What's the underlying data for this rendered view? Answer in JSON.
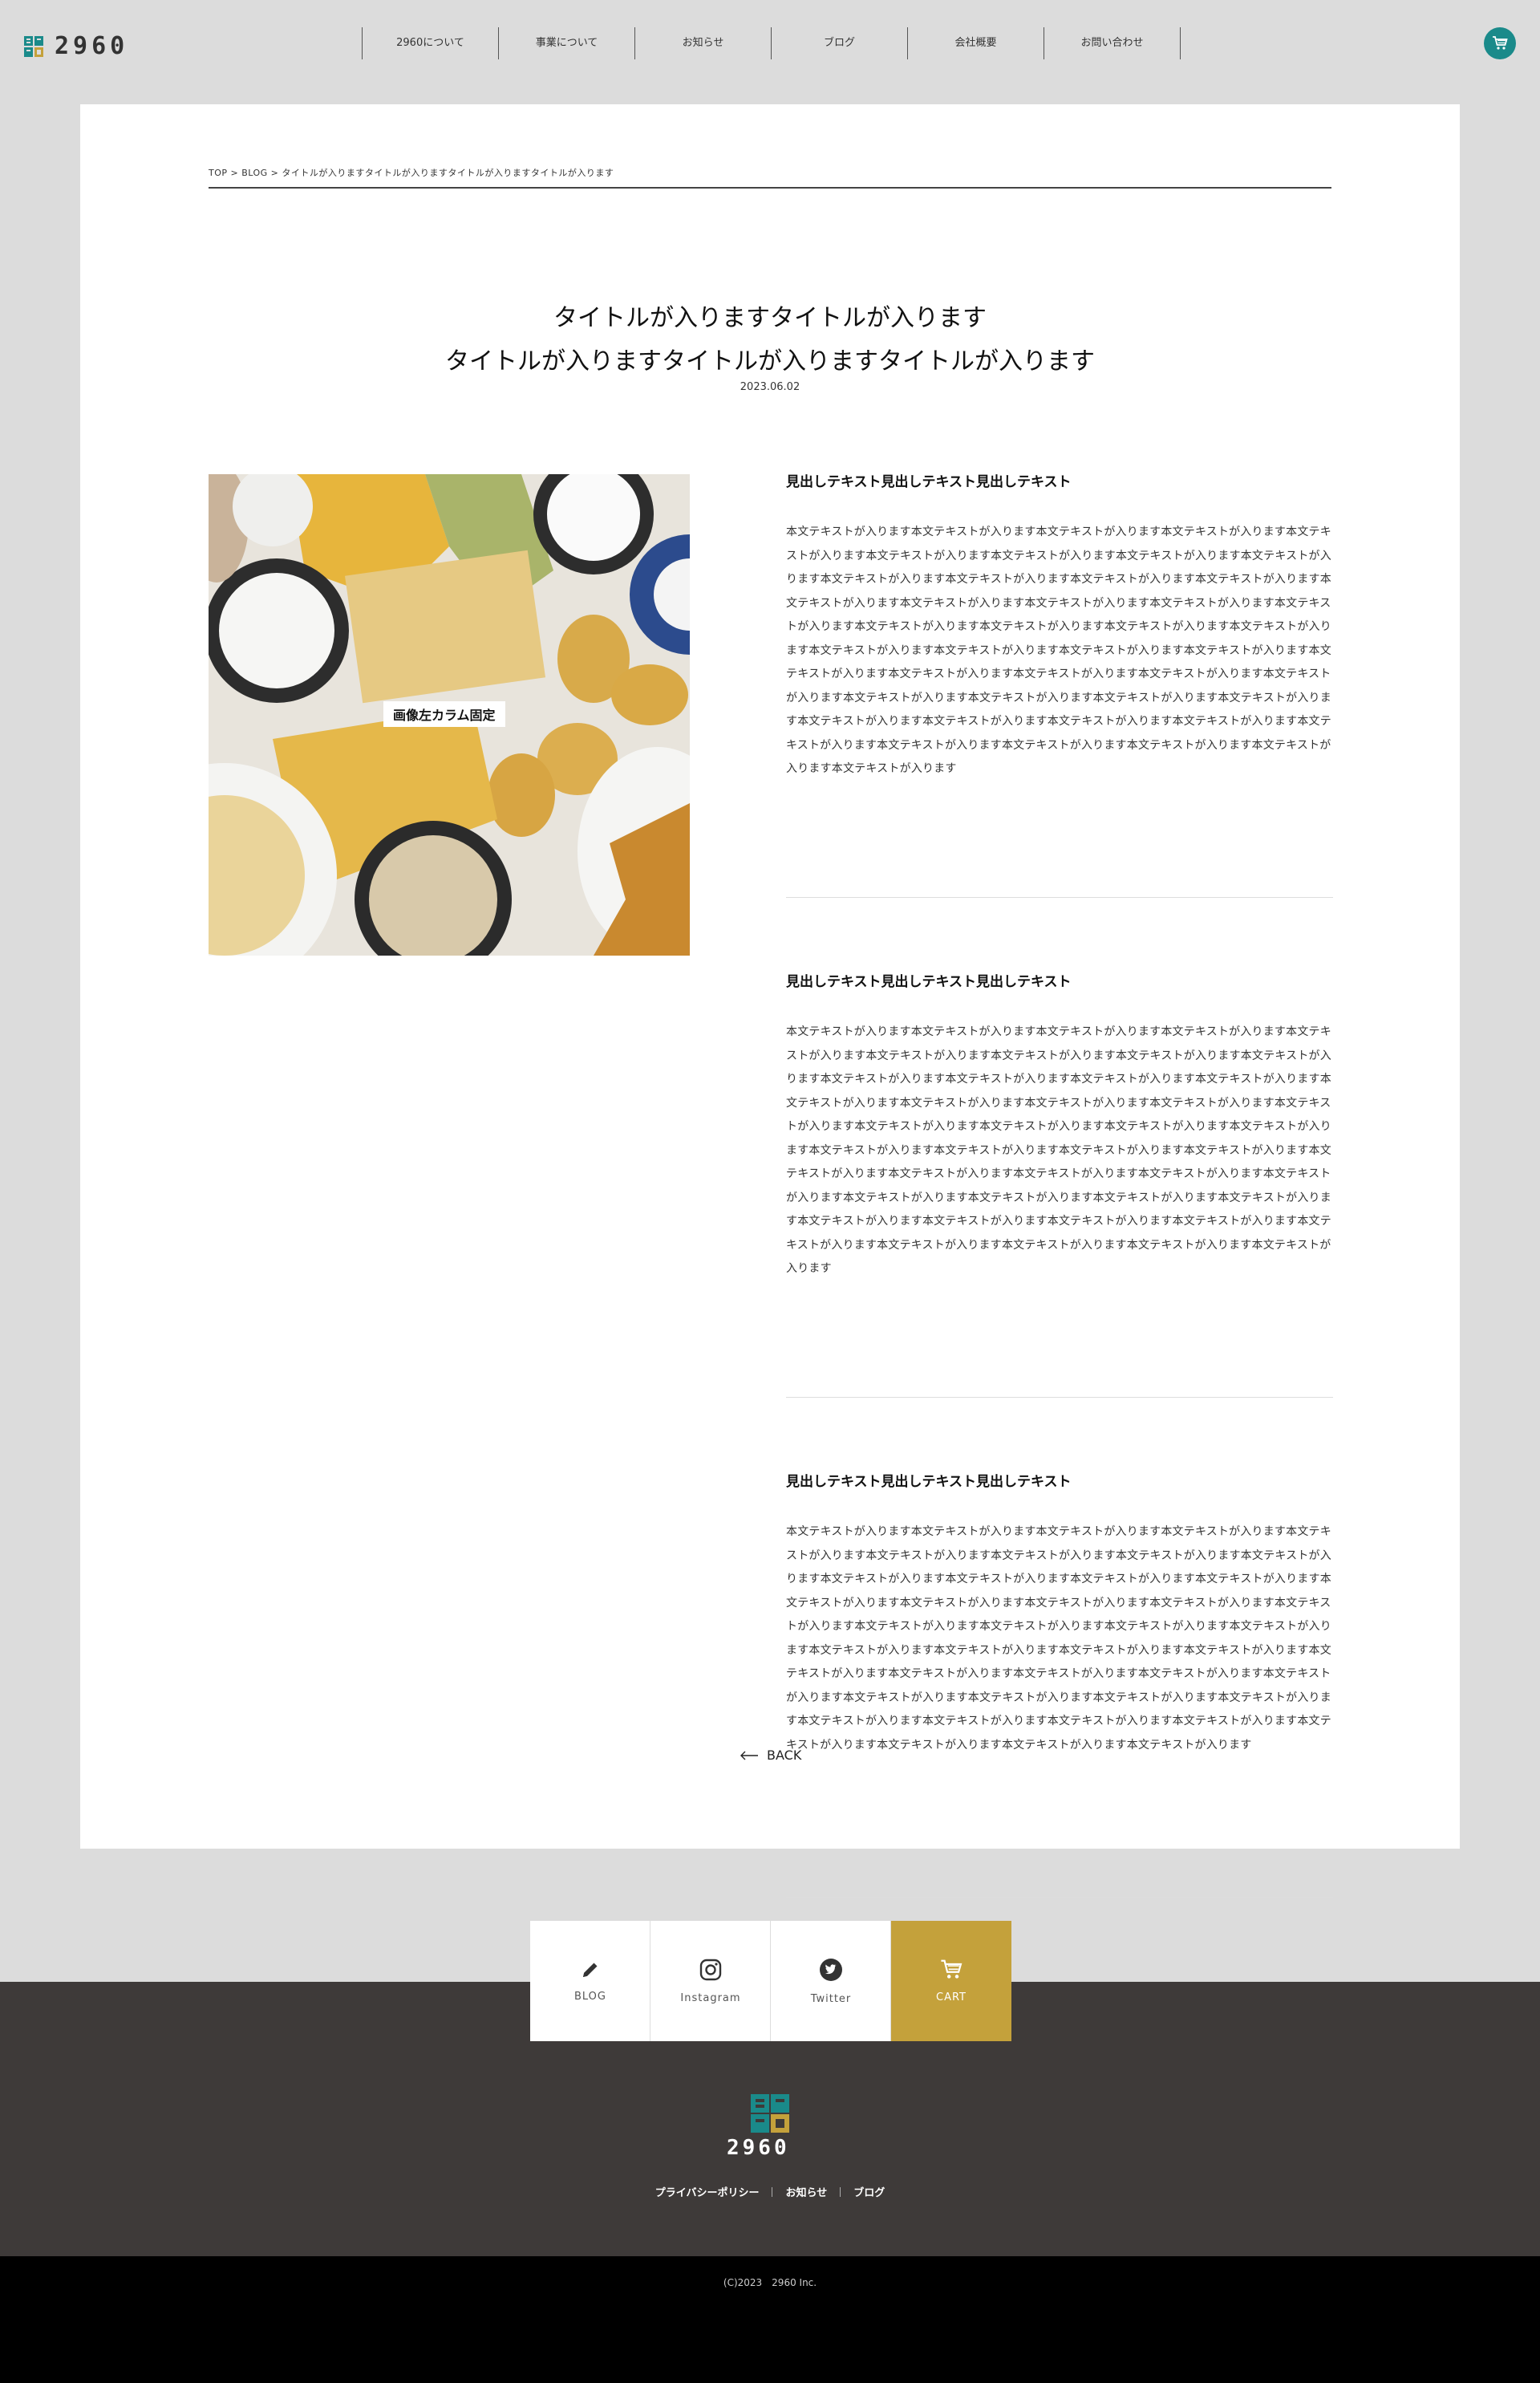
{
  "header": {
    "logo_text": "2960",
    "nav": [
      "2960について",
      "事業について",
      "お知らせ",
      "ブログ",
      "会社概要",
      "お問い合わせ"
    ]
  },
  "breadcrumb": "TOP > BLOG > タイトルが入りますタイトルが入りますタイトルが入りますタイトルが入ります",
  "article": {
    "title_line1": "タイトルが入りますタイトルが入ります",
    "title_line2": "タイトルが入りますタイトルが入りますタイトルが入ります",
    "date": "2023.06.02",
    "image_label": "画像左カラム固定",
    "sections": [
      {
        "heading": "見出しテキスト見出しテキスト見出しテキスト",
        "body": "本文テキストが入ります本文テキストが入ります本文テキストが入ります本文テキストが入ります本文テキストが入ります本文テキストが入ります本文テキストが入ります本文テキストが入ります本文テキストが入ります本文テキストが入ります本文テキストが入ります本文テキストが入ります本文テキストが入ります本文テキストが入ります本文テキストが入ります本文テキストが入ります本文テキストが入ります本文テキストが入ります本文テキストが入ります本文テキストが入ります本文テキストが入ります本文テキストが入ります本文テキストが入ります本文テキストが入ります本文テキストが入ります本文テキストが入ります本文テキストが入ります本文テキストが入ります本文テキストが入ります本文テキストが入ります本文テキストが入ります本文テキストが入ります本文テキストが入ります本文テキストが入ります本文テキストが入ります本文テキストが入ります本文テキストが入ります本文テキストが入ります本文テキストが入ります本文テキストが入ります本文テキストが入ります本文テキストが入ります本文テキストが入ります本文テキストが入ります本文テキストが入ります"
      },
      {
        "heading": "見出しテキスト見出しテキスト見出しテキスト",
        "body": "本文テキストが入ります本文テキストが入ります本文テキストが入ります本文テキストが入ります本文テキストが入ります本文テキストが入ります本文テキストが入ります本文テキストが入ります本文テキストが入ります本文テキストが入ります本文テキストが入ります本文テキストが入ります本文テキストが入ります本文テキストが入ります本文テキストが入ります本文テキストが入ります本文テキストが入ります本文テキストが入ります本文テキストが入ります本文テキストが入ります本文テキストが入ります本文テキストが入ります本文テキストが入ります本文テキストが入ります本文テキストが入ります本文テキストが入ります本文テキストが入ります本文テキストが入ります本文テキストが入ります本文テキストが入ります本文テキストが入ります本文テキストが入ります本文テキストが入ります本文テキストが入ります本文テキストが入ります本文テキストが入ります本文テキストが入ります本文テキストが入ります本文テキストが入ります本文テキストが入ります本文テキストが入ります本文テキストが入ります本文テキストが入ります本文テキストが入ります"
      },
      {
        "heading": "見出しテキスト見出しテキスト見出しテキスト",
        "body": "本文テキストが入ります本文テキストが入ります本文テキストが入ります本文テキストが入ります本文テキストが入ります本文テキストが入ります本文テキストが入ります本文テキストが入ります本文テキストが入ります本文テキストが入ります本文テキストが入ります本文テキストが入ります本文テキストが入ります本文テキストが入ります本文テキストが入ります本文テキストが入ります本文テキストが入ります本文テキストが入ります本文テキストが入ります本文テキストが入ります本文テキストが入ります本文テキストが入ります本文テキストが入ります本文テキストが入ります本文テキストが入ります本文テキストが入ります本文テキストが入ります本文テキストが入ります本文テキストが入ります本文テキストが入ります本文テキストが入ります本文テキストが入ります本文テキストが入ります本文テキストが入ります本文テキストが入ります本文テキストが入ります本文テキストが入ります本文テキストが入ります本文テキストが入ります本文テキストが入ります本文テキストが入ります本文テキストが入ります本文テキストが入ります"
      }
    ],
    "back_label": "BACK"
  },
  "social": [
    {
      "label": "BLOG",
      "icon": "pencil-icon"
    },
    {
      "label": "Instagram",
      "icon": "instagram-icon"
    },
    {
      "label": "Twitter",
      "icon": "twitter-icon"
    },
    {
      "label": "CART",
      "icon": "cart-icon"
    }
  ],
  "footer": {
    "logo_text": "2960",
    "links": [
      "プライバシーポリシー",
      "お知らせ",
      "ブログ"
    ],
    "copyright": "(C)2023　2960 Inc."
  },
  "colors": {
    "teal": "#1a8a8a",
    "gold": "#c4a13b",
    "footer_bg": "#3e3a39"
  }
}
